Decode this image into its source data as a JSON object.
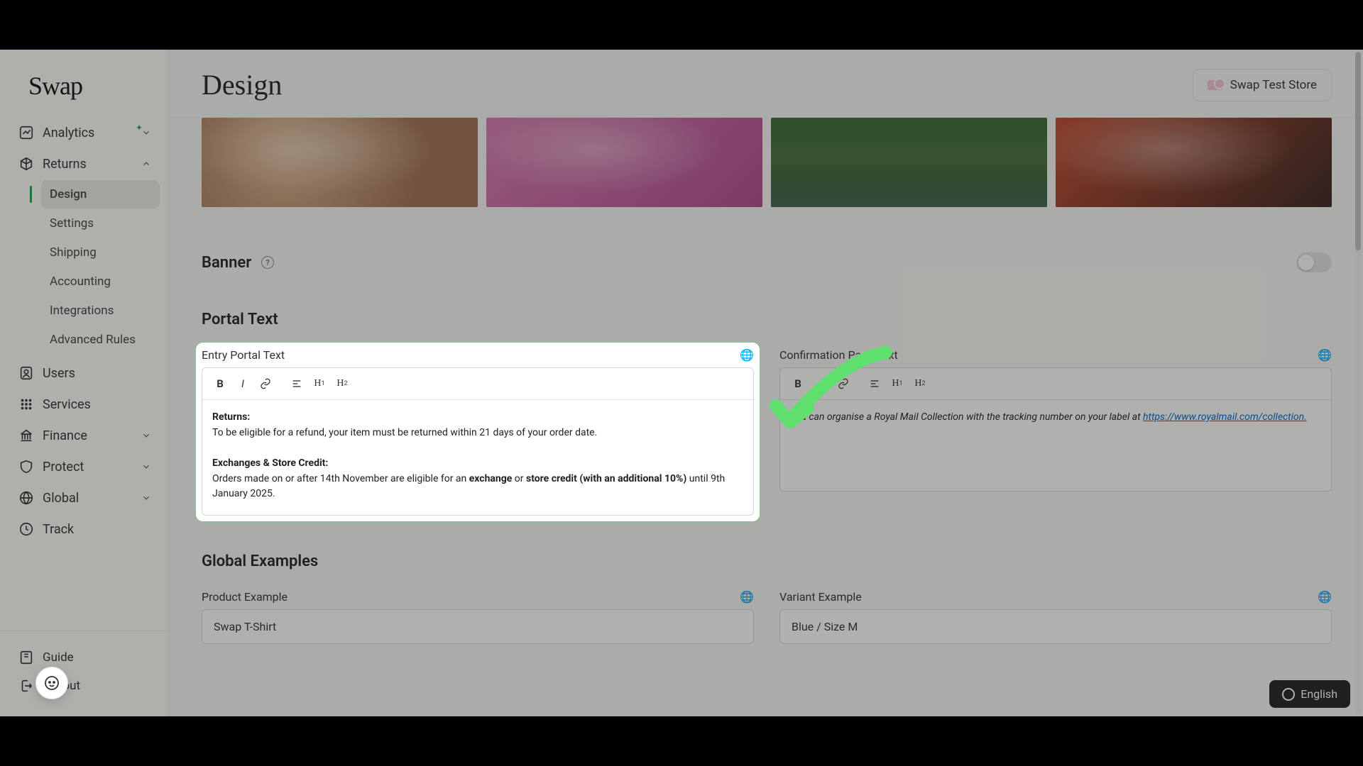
{
  "logo": "Swap",
  "page": {
    "title": "Design"
  },
  "store_chip": {
    "label": "Swap Test Store"
  },
  "nav": {
    "analytics": "Analytics",
    "returns": "Returns",
    "users": "Users",
    "services": "Services",
    "finance": "Finance",
    "protect": "Protect",
    "global": "Global",
    "track": "Track"
  },
  "returns_sub": {
    "design": "Design",
    "settings": "Settings",
    "shipping": "Shipping",
    "accounting": "Accounting",
    "integrations": "Integrations",
    "advanced_rules": "Advanced Rules"
  },
  "footer": {
    "guide": "Guide",
    "logout": "Logout"
  },
  "sections": {
    "banner": "Banner",
    "portal_text": "Portal Text",
    "global_examples": "Global Examples"
  },
  "entry_portal": {
    "label": "Entry Portal Text",
    "returns_heading": "Returns:",
    "returns_body": "To be eligible for a refund, your item must be returned within 21 days of your order date.",
    "exchanges_heading": "Exchanges & Store Credit:",
    "exchanges_pre": "Orders made on or after 14th November are eligible for an ",
    "exchange_bold": "exchange",
    "or_text": " or ",
    "store_credit_bold": "store credit (with an additional 10%)",
    "exchanges_post": " until 9th January 2025."
  },
  "confirmation": {
    "label": "Confirmation Page Text",
    "body_pre": "You can organise a Royal Mail Collection with the tracking number on your label at ",
    "link_text": "https://www.royalmail.com/collection.",
    "link_href": "https://www.royalmail.com/collection"
  },
  "product_example": {
    "label": "Product Example",
    "value": "Swap T-Shirt"
  },
  "variant_example": {
    "label": "Variant Example",
    "value": "Blue / Size M"
  },
  "language": "English",
  "highlight": {
    "target": "entry_portal_text_editor",
    "accent": "#5FE06E"
  }
}
